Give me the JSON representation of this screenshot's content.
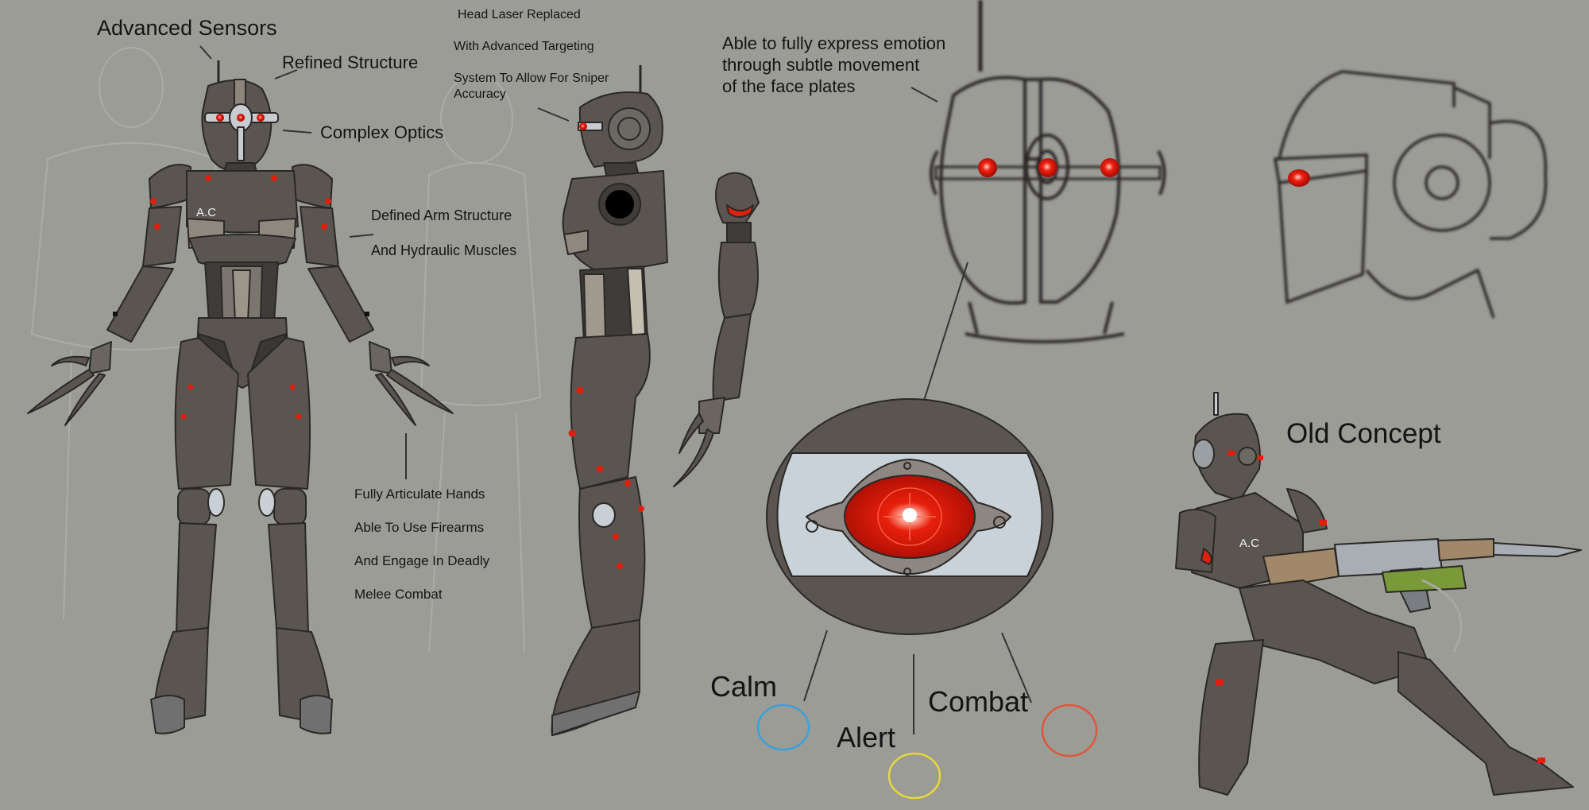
{
  "sheet": {
    "background_color": "#9c9c97",
    "armor_color": "#5a5550",
    "accent_color": "#e0200f"
  },
  "front_view": {
    "callouts": {
      "sensors": "Advanced Sensors",
      "structure": "Refined Structure",
      "optics": "Complex Optics",
      "arm_line1": "Defined Arm Structure",
      "arm_line2": "And Hydraulic Muscles",
      "hands_line1": "Fully Articulate Hands",
      "hands_line2": "Able To Use Firearms",
      "hands_line3": "And Engage In Deadly",
      "hands_line4": "Melee Combat"
    },
    "chest_marking": "A.C"
  },
  "side_view": {
    "callouts": {
      "laser_line1": "Head Laser Replaced",
      "laser_line2": "With Advanced Targeting",
      "laser_line3": "System To Allow For Sniper",
      "laser_line4": "Accuracy"
    }
  },
  "head_detail": {
    "callout_line1": "Able to fully express emotion",
    "callout_line2": "through subtle movement",
    "callout_line3": "of the face plates"
  },
  "eye_states": [
    {
      "label": "Calm",
      "color": "#3aa0d8"
    },
    {
      "label": "Alert",
      "color": "#e6d83a"
    },
    {
      "label": "Combat",
      "color": "#e0553a"
    }
  ],
  "old_concept": {
    "title": "Old Concept",
    "chest_marking": "A.C"
  }
}
